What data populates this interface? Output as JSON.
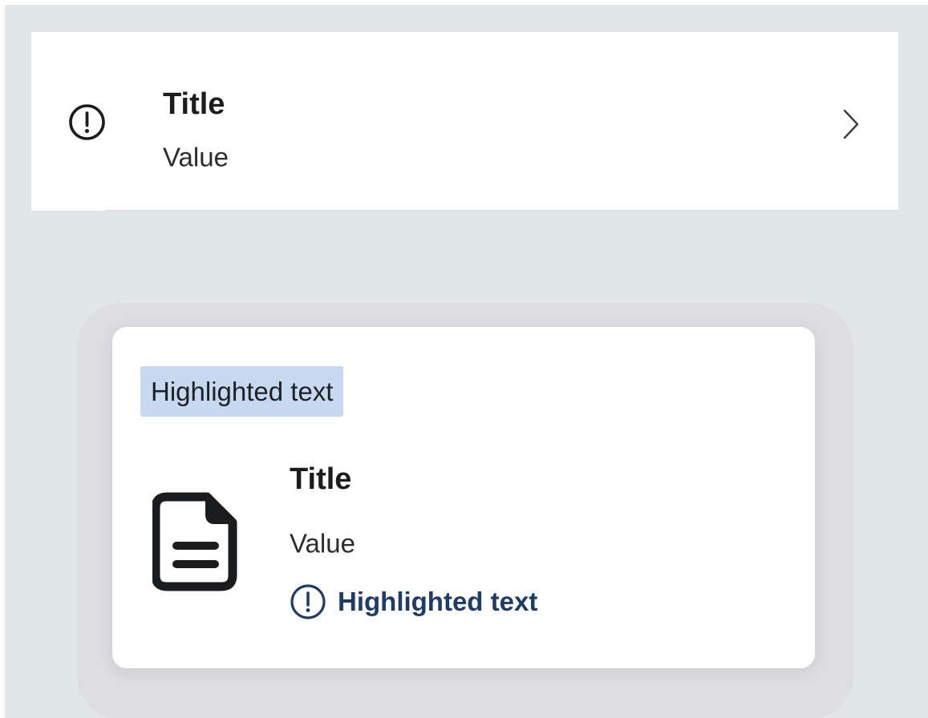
{
  "list_row": {
    "icon": "alert-circle-icon",
    "title": "Title",
    "value": "Value",
    "trailing_icon": "chevron-right-icon"
  },
  "card": {
    "tag_label": "Highlighted text",
    "icon": "document-icon",
    "title": "Title",
    "value": "Value",
    "notice_icon": "alert-circle-icon",
    "notice_text": "Highlighted text"
  },
  "colors": {
    "background": "#e1e6e7",
    "surface": "#ffffff",
    "text_primary": "#1b1c1e",
    "tag_background": "#c6d9f1",
    "notice_accent": "#1e3c66"
  }
}
